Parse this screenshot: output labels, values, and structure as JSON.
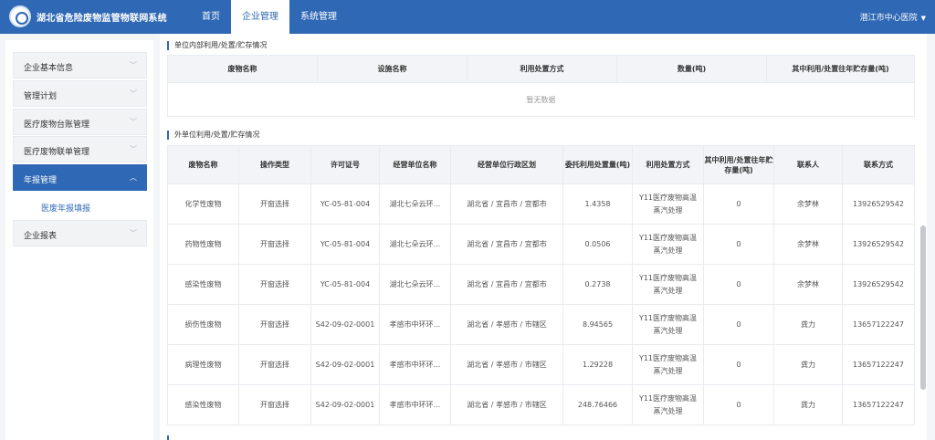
{
  "header": {
    "title": "湖北省危险废物监管物联网系统",
    "nav": [
      "首页",
      "企业管理",
      "系统管理"
    ],
    "active_nav": 1,
    "user": "潜江市中心医院"
  },
  "sidebar": {
    "items": [
      {
        "label": "企业基本信息"
      },
      {
        "label": "管理计划"
      },
      {
        "label": "医疗废物台账管理"
      },
      {
        "label": "医疗废物联单管理"
      },
      {
        "label": "年报管理"
      },
      {
        "label": "企业报表"
      }
    ],
    "active_index": 4,
    "sub_item": "医废年报填报"
  },
  "internal_section": {
    "title": "单位内部利用/处置/贮存情况",
    "headers": [
      "废物名称",
      "设施名称",
      "利用处置方式",
      "数量(吨)",
      "其中利用/处置往年贮存量(吨)"
    ],
    "empty_text": "暂无数据"
  },
  "external_section": {
    "title": "外单位利用/处置/贮存情况",
    "headers": [
      "废物名称",
      "操作类型",
      "许可证号",
      "经营单位名称",
      "经营单位行政区划",
      "委托利用处置量(吨)",
      "利用处置方式",
      "其中利用/处置往年贮存量(吨)",
      "联系人",
      "联系方式"
    ],
    "rows": [
      [
        "化学性废物",
        "开窗选择",
        "YC-05-81-004",
        "湖北七朵云环...",
        "湖北省 / 宜昌市 / 宜都市",
        "1.4358",
        "Y11医疗废物高温蒸汽处理",
        "0",
        "余梦林",
        "13926529542"
      ],
      [
        "药物性废物",
        "开窗选择",
        "YC-05-81-004",
        "湖北七朵云环...",
        "湖北省 / 宜昌市 / 宜都市",
        "0.0506",
        "Y11医疗废物高温蒸汽处理",
        "0",
        "余梦林",
        "13926529542"
      ],
      [
        "感染性废物",
        "开窗选择",
        "YC-05-81-004",
        "湖北七朵云环...",
        "湖北省 / 宜昌市 / 宜都市",
        "0.2738",
        "Y11医疗废物高温蒸汽处理",
        "0",
        "余梦林",
        "13926529542"
      ],
      [
        "损伤性废物",
        "开窗选择",
        "S42-09-02-0001",
        "孝感市中环环...",
        "湖北省 / 孝感市 / 市辖区",
        "8.94565",
        "Y11医疗废物高温蒸汽处理",
        "0",
        "龚力",
        "13657122247"
      ],
      [
        "病理性废物",
        "开窗选择",
        "S42-09-02-0001",
        "孝感市中环环...",
        "湖北省 / 孝感市 / 市辖区",
        "1.29228",
        "Y11医疗废物高温蒸汽处理",
        "0",
        "龚力",
        "13657122247"
      ],
      [
        "感染性废物",
        "开窗选择",
        "S42-09-02-0001",
        "孝感市中环环...",
        "湖北省 / 孝感市 / 市辖区",
        "248.76466",
        "Y11医疗废物高温蒸汽处理",
        "0",
        "龚力",
        "13657122247"
      ]
    ]
  }
}
